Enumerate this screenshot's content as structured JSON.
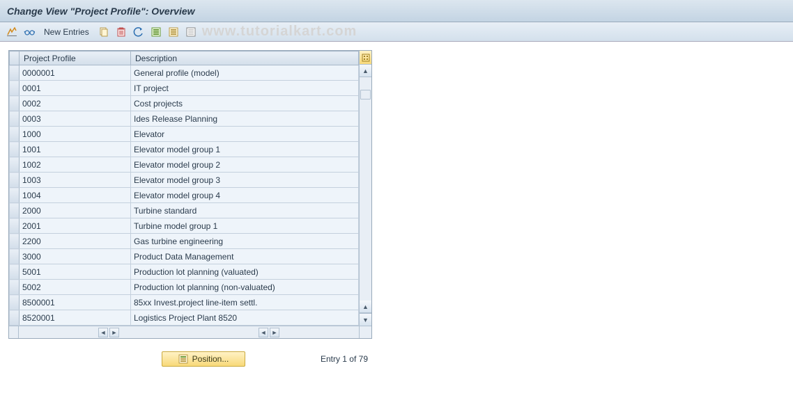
{
  "title": "Change View \"Project Profile\": Overview",
  "toolbar": {
    "new_entries": "New Entries"
  },
  "watermark": "www.tutorialkart.com",
  "columns": {
    "profile": "Project Profile",
    "description": "Description"
  },
  "rows": [
    {
      "profile": "0000001",
      "desc": "General profile (model)"
    },
    {
      "profile": "0001",
      "desc": "IT project"
    },
    {
      "profile": "0002",
      "desc": "Cost projects"
    },
    {
      "profile": "0003",
      "desc": "Ides Release Planning"
    },
    {
      "profile": "1000",
      "desc": "Elevator"
    },
    {
      "profile": "1001",
      "desc": "Elevator model group 1"
    },
    {
      "profile": "1002",
      "desc": "Elevator model group 2"
    },
    {
      "profile": "1003",
      "desc": "Elevator model group 3"
    },
    {
      "profile": "1004",
      "desc": "Elevator model group 4"
    },
    {
      "profile": "2000",
      "desc": "Turbine standard"
    },
    {
      "profile": "2001",
      "desc": "Turbine model group 1"
    },
    {
      "profile": "2200",
      "desc": "Gas turbine engineering"
    },
    {
      "profile": "3000",
      "desc": "Product Data Management"
    },
    {
      "profile": "5001",
      "desc": "Production lot planning (valuated)"
    },
    {
      "profile": "5002",
      "desc": "Production lot planning (non-valuated)"
    },
    {
      "profile": "8500001",
      "desc": "85xx Invest.project line-item settl."
    },
    {
      "profile": "8520001",
      "desc": "Logistics Project Plant 8520"
    }
  ],
  "footer": {
    "position_label": "Position...",
    "entry_text": "Entry 1 of 79"
  }
}
